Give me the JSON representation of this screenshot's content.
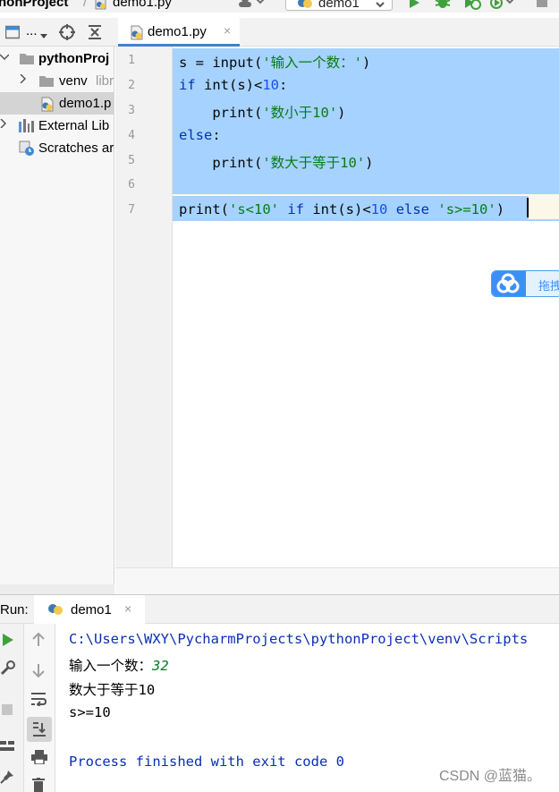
{
  "window": {
    "breadcrumb_project": "honProject",
    "breadcrumb_file": "demo1.py",
    "run_config": "demo1"
  },
  "project_toolbar": {
    "view_label": "..."
  },
  "editor_tab": {
    "label": "demo1.py",
    "close": "×"
  },
  "project_tree": [
    {
      "label": "pythonProj"
    },
    {
      "label": "venv",
      "suffix": "libr"
    },
    {
      "label": "demo1.p"
    },
    {
      "label": "External Lib"
    },
    {
      "label": "Scratches ar"
    }
  ],
  "editor": {
    "line_numbers": [
      "1",
      "2",
      "3",
      "4",
      "5",
      "6",
      "7"
    ],
    "lines": [
      [
        {
          "t": "s = input(",
          "c": ""
        },
        {
          "t": "'输入一个数：'",
          "c": "str"
        },
        {
          "t": ")",
          "c": ""
        }
      ],
      [
        {
          "t": "if",
          "c": "kw"
        },
        {
          "t": " int(s)<",
          "c": ""
        },
        {
          "t": "10",
          "c": "num"
        },
        {
          "t": ":",
          "c": ""
        }
      ],
      [
        {
          "t": "    print(",
          "c": ""
        },
        {
          "t": "'数小于10'",
          "c": "str"
        },
        {
          "t": ")",
          "c": ""
        }
      ],
      [
        {
          "t": "else",
          "c": "kw"
        },
        {
          "t": ":",
          "c": ""
        }
      ],
      [
        {
          "t": "    print(",
          "c": ""
        },
        {
          "t": "'数大于等于10'",
          "c": "str"
        },
        {
          "t": ")",
          "c": ""
        }
      ],
      [],
      [
        {
          "t": "print(",
          "c": ""
        },
        {
          "t": "'s<10'",
          "c": "str"
        },
        {
          "t": " ",
          "c": ""
        },
        {
          "t": "if",
          "c": "kw"
        },
        {
          "t": " int(s)<",
          "c": ""
        },
        {
          "t": "10",
          "c": "num"
        },
        {
          "t": " ",
          "c": ""
        },
        {
          "t": "else",
          "c": "kw"
        },
        {
          "t": " ",
          "c": ""
        },
        {
          "t": "'s>=10'",
          "c": "str"
        },
        {
          "t": ")",
          "c": ""
        }
      ]
    ]
  },
  "floating_bar": {
    "label": "拖拽"
  },
  "run_panel": {
    "label": "Run:",
    "tab_label": "demo1",
    "tab_close": "×",
    "console": {
      "path_line": "C:\\Users\\WXY\\PycharmProjects\\pythonProject\\venv\\Scripts",
      "prompt": "输入一个数：",
      "user_input": "32",
      "output_1": "数大于等于10",
      "output_2": "s>=10",
      "finish": "Process finished with exit code 0"
    }
  },
  "watermark": "CSDN @蓝猫。",
  "colors": {
    "selection": "#a6d2ff",
    "keyword": "#0033b3",
    "number": "#1750eb",
    "string": "#067d17",
    "console_blue": "#0b2fb5"
  }
}
